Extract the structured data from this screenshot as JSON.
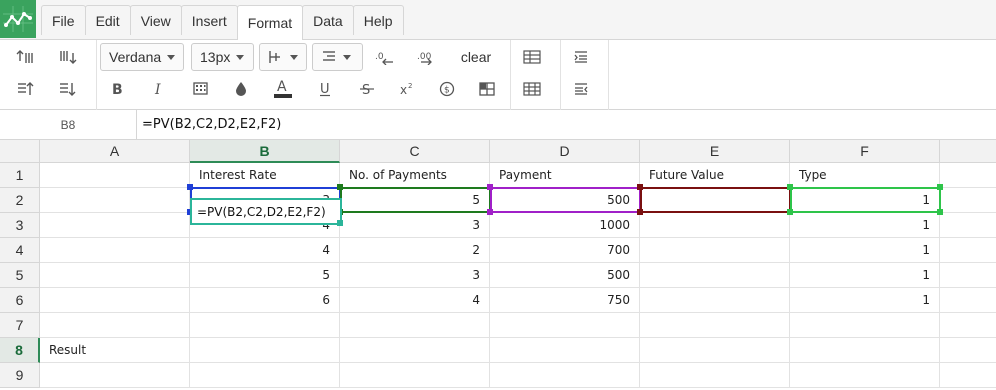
{
  "menu": {
    "tabs": [
      {
        "label": "File"
      },
      {
        "label": "Edit"
      },
      {
        "label": "View"
      },
      {
        "label": "Insert"
      },
      {
        "label": "Format"
      },
      {
        "label": "Data"
      },
      {
        "label": "Help"
      }
    ],
    "active_tab": "Format"
  },
  "toolbar": {
    "font_family": "Verdana",
    "font_size": "13px",
    "clear_label": "clear"
  },
  "formula_bar": {
    "cell_ref": "B8",
    "formula": "=PV(B2,C2,D2,E2,F2)"
  },
  "sheet": {
    "columns": [
      "A",
      "B",
      "C",
      "D",
      "E",
      "F"
    ],
    "selected_column": "B",
    "selected_row": "8",
    "rows": [
      {
        "num": "1",
        "cells": [
          "",
          "Interest Rate",
          "No. of Payments",
          "Payment",
          "Future Value",
          "Type"
        ]
      },
      {
        "num": "2",
        "cells": [
          "",
          "3",
          "5",
          "500",
          "",
          "1"
        ]
      },
      {
        "num": "3",
        "cells": [
          "",
          "4",
          "3",
          "1000",
          "",
          "1"
        ]
      },
      {
        "num": "4",
        "cells": [
          "",
          "4",
          "2",
          "700",
          "",
          "1"
        ]
      },
      {
        "num": "5",
        "cells": [
          "",
          "5",
          "3",
          "500",
          "",
          "1"
        ]
      },
      {
        "num": "6",
        "cells": [
          "",
          "6",
          "4",
          "750",
          "",
          "1"
        ]
      },
      {
        "num": "7",
        "cells": [
          "",
          "",
          "",
          "",
          "",
          ""
        ]
      },
      {
        "num": "8",
        "cells": [
          "Result",
          "",
          "",
          "",
          "",
          ""
        ]
      },
      {
        "num": "9",
        "cells": [
          "",
          "",
          "",
          "",
          "",
          ""
        ]
      }
    ],
    "editor_value": "=PV(B2,C2,D2,E2,F2)",
    "reference_colors": {
      "B2": "#1f3fd6",
      "C2": "#1e7a1e",
      "D2": "#a020c8",
      "E2": "#7a1010",
      "F2": "#2ec44a"
    },
    "editor_border_color": "#2bb59a"
  }
}
